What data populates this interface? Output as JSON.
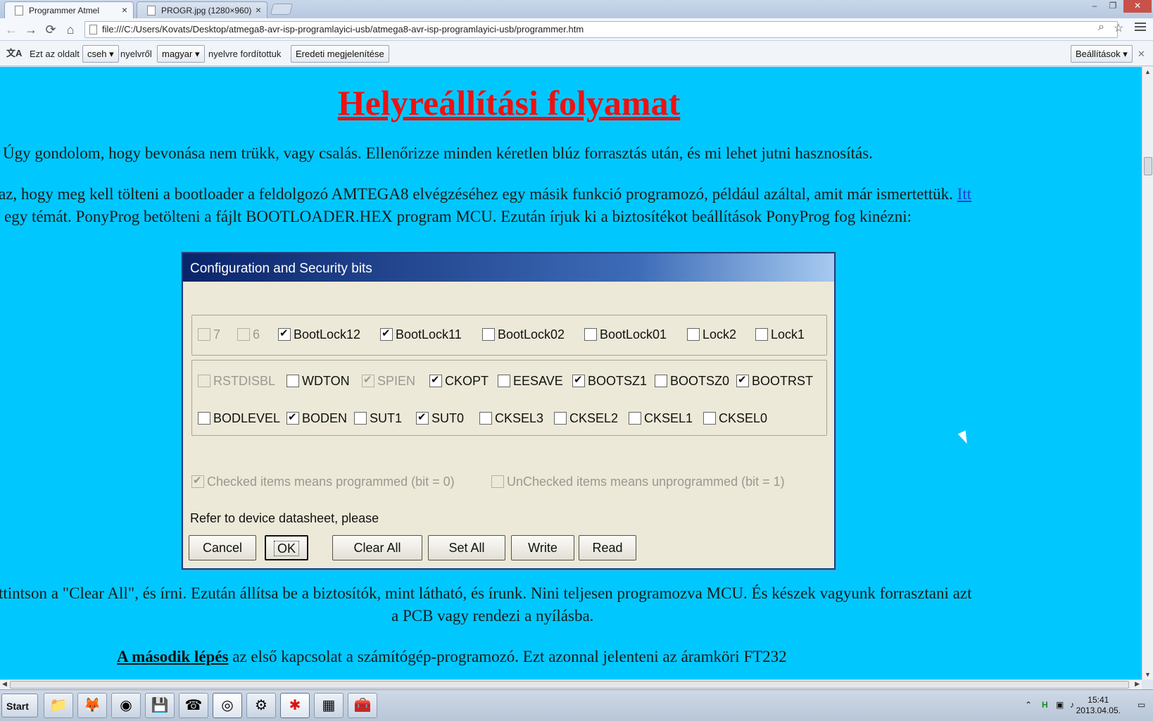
{
  "browser": {
    "tabs": [
      {
        "label": "Programmer Atmel",
        "active": true
      },
      {
        "label": "PROGR.jpg (1280×960)",
        "active": false
      }
    ],
    "tab_close": "×",
    "address": "file:///C:/Users/Kovats/Desktop/atmega8-avr-isp-programlayici-usb/atmega8-avr-isp-programlayici-usb/programmer.htm",
    "nav": {
      "back": "←",
      "forward": "→",
      "reload": "⟳",
      "home": "⌂"
    },
    "window_controls": {
      "minimize": "–",
      "restore": "❐",
      "close": "✕"
    }
  },
  "translate": {
    "icon": "文A",
    "prefix": "Ezt az oldalt",
    "from_lang": "cseh ▾",
    "mid": "nyelvről",
    "to_lang": "magyar ▾",
    "suffix": "nyelvre fordítottuk",
    "show_original": "Eredeti megjelenítése",
    "settings": "Beállítások ▾",
    "close": "✕"
  },
  "page": {
    "title": "Helyreállítási folyamat",
    "p1": "Úgy gondolom, hogy bevonása nem trükk, vagy csalás. Ellenőrizze minden kéretlen blúz forrasztás után, és mi lehet jutni hasznosítás.",
    "p2_line1": "az, hogy meg kell tölteni a bootloader a feldolgozó AMTEGA8 elvégzéséhez egy másik funkció programozó, például azáltal, amit már ismertettük.",
    "p2_link": "Itt",
    "p2_line2": "egy témát. PonyProg betölteni a fájlt BOOTLOADER.HEX program MCU. Ezután írjuk ki a biztosítékot beállítások PonyProg fog kinézni:",
    "p3_line1": "ttintson a \"Clear All\", és írni. Ezután állítsa be a biztosítók, mint látható, és írunk. Nini teljesen programozva MCU. És készek vagyunk forrasztani azt",
    "p3_line2": "a PCB vagy rendezi a nyílásba.",
    "p4_bold": "A második lépés",
    "p4_rest": "az első kapcsolat a számítógép-programozó. Ezt azonnal jelenteni az áramköri FT232"
  },
  "dialog": {
    "title": "Configuration and Security bits",
    "lock_row": [
      {
        "label": "7",
        "checked": false,
        "disabled": true
      },
      {
        "label": "6",
        "checked": false,
        "disabled": true
      },
      {
        "label": "BootLock12",
        "checked": true
      },
      {
        "label": "BootLock11",
        "checked": true
      },
      {
        "label": "BootLock02",
        "checked": false
      },
      {
        "label": "BootLock01",
        "checked": false
      },
      {
        "label": "Lock2",
        "checked": false
      },
      {
        "label": "Lock1",
        "checked": false
      }
    ],
    "fuse_row1": [
      {
        "label": "RSTDISBL",
        "checked": false,
        "disabled": true
      },
      {
        "label": "WDTON",
        "checked": false
      },
      {
        "label": "SPIEN",
        "checked": true,
        "disabled": true
      },
      {
        "label": "CKOPT",
        "checked": true
      },
      {
        "label": "EESAVE",
        "checked": false
      },
      {
        "label": "BOOTSZ1",
        "checked": true
      },
      {
        "label": "BOOTSZ0",
        "checked": false
      },
      {
        "label": "BOOTRST",
        "checked": true
      }
    ],
    "fuse_row2": [
      {
        "label": "BODLEVEL",
        "checked": false
      },
      {
        "label": "BODEN",
        "checked": true
      },
      {
        "label": "SUT1",
        "checked": false
      },
      {
        "label": "SUT0",
        "checked": true
      },
      {
        "label": "CKSEL3",
        "checked": false
      },
      {
        "label": "CKSEL2",
        "checked": false
      },
      {
        "label": "CKSEL1",
        "checked": false
      },
      {
        "label": "CKSEL0",
        "checked": false
      }
    ],
    "legend_checked": "Checked items means programmed (bit = 0)",
    "legend_unchecked": "UnChecked items means unprogrammed (bit = 1)",
    "note": "Refer to device datasheet, please",
    "buttons": {
      "cancel": "Cancel",
      "ok": "OK",
      "clear_all": "Clear All",
      "set_all": "Set All",
      "write": "Write",
      "read": "Read"
    }
  },
  "taskbar": {
    "start": "Start",
    "apps": [
      "📁",
      "🦊",
      "◉",
      "💾",
      "☎",
      "◎",
      "⚙",
      "✱",
      "▦",
      "🧰"
    ],
    "clock_time": "15:41",
    "clock_date": "2013.04.05."
  }
}
